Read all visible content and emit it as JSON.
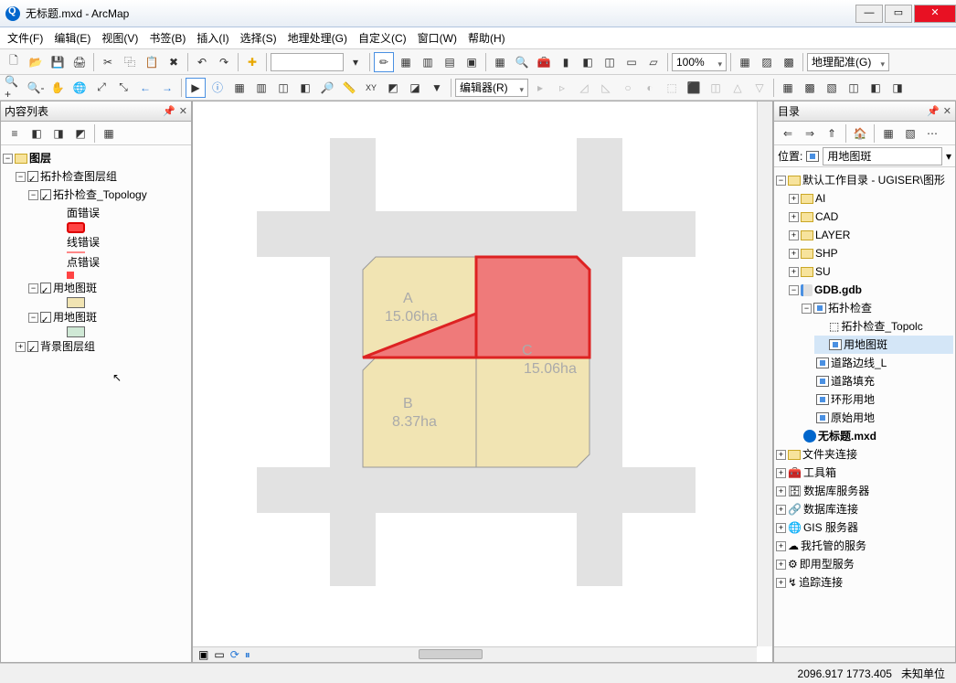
{
  "window": {
    "title": "无标题.mxd - ArcMap"
  },
  "menu": [
    "文件(F)",
    "编辑(E)",
    "视图(V)",
    "书签(B)",
    "插入(I)",
    "选择(S)",
    "地理处理(G)",
    "自定义(C)",
    "窗口(W)",
    "帮助(H)"
  ],
  "scale_value": "100%",
  "editor_label": "编辑器(R)",
  "georef_label": "地理配准(G)",
  "toc": {
    "title": "内容列表",
    "root": "图层",
    "items": {
      "topo_group": "拓扑检查图层组",
      "topo_layer": "拓扑检查_Topology",
      "area_err": "面错误",
      "line_err": "线错误",
      "point_err": "点错误",
      "parcel1": "用地图斑",
      "parcel2": "用地图斑",
      "bg_group": "背景图层组"
    }
  },
  "catalog": {
    "title": "目录",
    "location_label": "位置:",
    "location_value": "用地图斑",
    "nodes": {
      "home": "默认工作目录 - UGISER\\图形",
      "ai": "AI",
      "cad": "CAD",
      "layer": "LAYER",
      "shp": "SHP",
      "su": "SU",
      "gdb": "GDB.gdb",
      "topo_ds": "拓扑检查",
      "topo_fc": "拓扑检查_Topolc",
      "parcel_fc": "用地图斑",
      "road_line": "道路边线_L",
      "road_fill": "道路填充",
      "ring": "环形用地",
      "orig": "原始用地",
      "mxd": "无标题.mxd",
      "folder_conn": "文件夹连接",
      "toolbox": "工具箱",
      "dbserver": "数据库服务器",
      "dbconn": "数据库连接",
      "gisserver": "GIS 服务器",
      "myhosted": "我托管的服务",
      "ready": "即用型服务",
      "trace": "追踪连接"
    }
  },
  "map": {
    "parcels": {
      "A": {
        "label": "A",
        "area": "15.06ha"
      },
      "B": {
        "label": "B",
        "area": "8.37ha"
      },
      "C": {
        "label": "C",
        "area": "15.06ha"
      }
    }
  },
  "status": {
    "coords": "2096.917 1773.405",
    "units": "未知单位"
  }
}
